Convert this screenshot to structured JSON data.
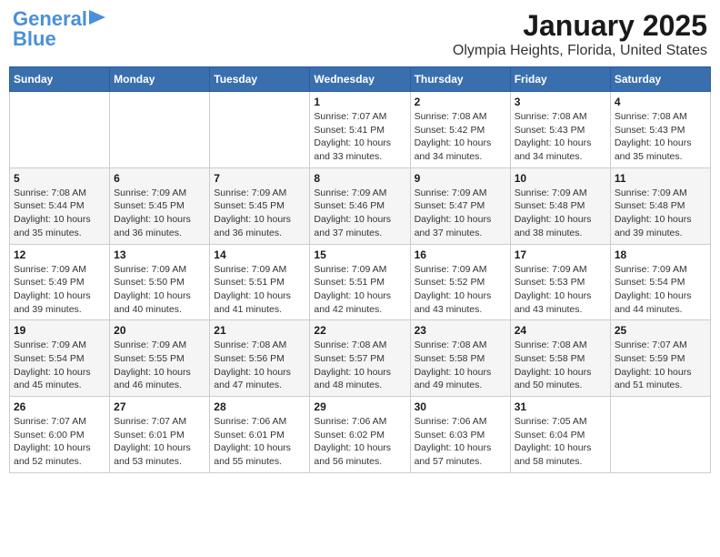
{
  "header": {
    "logo_line1": "General",
    "logo_line2": "Blue",
    "title": "January 2025",
    "subtitle": "Olympia Heights, Florida, United States"
  },
  "weekdays": [
    "Sunday",
    "Monday",
    "Tuesday",
    "Wednesday",
    "Thursday",
    "Friday",
    "Saturday"
  ],
  "weeks": [
    [
      {
        "day": "",
        "info": ""
      },
      {
        "day": "",
        "info": ""
      },
      {
        "day": "",
        "info": ""
      },
      {
        "day": "1",
        "info": "Sunrise: 7:07 AM\nSunset: 5:41 PM\nDaylight: 10 hours\nand 33 minutes."
      },
      {
        "day": "2",
        "info": "Sunrise: 7:08 AM\nSunset: 5:42 PM\nDaylight: 10 hours\nand 34 minutes."
      },
      {
        "day": "3",
        "info": "Sunrise: 7:08 AM\nSunset: 5:43 PM\nDaylight: 10 hours\nand 34 minutes."
      },
      {
        "day": "4",
        "info": "Sunrise: 7:08 AM\nSunset: 5:43 PM\nDaylight: 10 hours\nand 35 minutes."
      }
    ],
    [
      {
        "day": "5",
        "info": "Sunrise: 7:08 AM\nSunset: 5:44 PM\nDaylight: 10 hours\nand 35 minutes."
      },
      {
        "day": "6",
        "info": "Sunrise: 7:09 AM\nSunset: 5:45 PM\nDaylight: 10 hours\nand 36 minutes."
      },
      {
        "day": "7",
        "info": "Sunrise: 7:09 AM\nSunset: 5:45 PM\nDaylight: 10 hours\nand 36 minutes."
      },
      {
        "day": "8",
        "info": "Sunrise: 7:09 AM\nSunset: 5:46 PM\nDaylight: 10 hours\nand 37 minutes."
      },
      {
        "day": "9",
        "info": "Sunrise: 7:09 AM\nSunset: 5:47 PM\nDaylight: 10 hours\nand 37 minutes."
      },
      {
        "day": "10",
        "info": "Sunrise: 7:09 AM\nSunset: 5:48 PM\nDaylight: 10 hours\nand 38 minutes."
      },
      {
        "day": "11",
        "info": "Sunrise: 7:09 AM\nSunset: 5:48 PM\nDaylight: 10 hours\nand 39 minutes."
      }
    ],
    [
      {
        "day": "12",
        "info": "Sunrise: 7:09 AM\nSunset: 5:49 PM\nDaylight: 10 hours\nand 39 minutes."
      },
      {
        "day": "13",
        "info": "Sunrise: 7:09 AM\nSunset: 5:50 PM\nDaylight: 10 hours\nand 40 minutes."
      },
      {
        "day": "14",
        "info": "Sunrise: 7:09 AM\nSunset: 5:51 PM\nDaylight: 10 hours\nand 41 minutes."
      },
      {
        "day": "15",
        "info": "Sunrise: 7:09 AM\nSunset: 5:51 PM\nDaylight: 10 hours\nand 42 minutes."
      },
      {
        "day": "16",
        "info": "Sunrise: 7:09 AM\nSunset: 5:52 PM\nDaylight: 10 hours\nand 43 minutes."
      },
      {
        "day": "17",
        "info": "Sunrise: 7:09 AM\nSunset: 5:53 PM\nDaylight: 10 hours\nand 43 minutes."
      },
      {
        "day": "18",
        "info": "Sunrise: 7:09 AM\nSunset: 5:54 PM\nDaylight: 10 hours\nand 44 minutes."
      }
    ],
    [
      {
        "day": "19",
        "info": "Sunrise: 7:09 AM\nSunset: 5:54 PM\nDaylight: 10 hours\nand 45 minutes."
      },
      {
        "day": "20",
        "info": "Sunrise: 7:09 AM\nSunset: 5:55 PM\nDaylight: 10 hours\nand 46 minutes."
      },
      {
        "day": "21",
        "info": "Sunrise: 7:08 AM\nSunset: 5:56 PM\nDaylight: 10 hours\nand 47 minutes."
      },
      {
        "day": "22",
        "info": "Sunrise: 7:08 AM\nSunset: 5:57 PM\nDaylight: 10 hours\nand 48 minutes."
      },
      {
        "day": "23",
        "info": "Sunrise: 7:08 AM\nSunset: 5:58 PM\nDaylight: 10 hours\nand 49 minutes."
      },
      {
        "day": "24",
        "info": "Sunrise: 7:08 AM\nSunset: 5:58 PM\nDaylight: 10 hours\nand 50 minutes."
      },
      {
        "day": "25",
        "info": "Sunrise: 7:07 AM\nSunset: 5:59 PM\nDaylight: 10 hours\nand 51 minutes."
      }
    ],
    [
      {
        "day": "26",
        "info": "Sunrise: 7:07 AM\nSunset: 6:00 PM\nDaylight: 10 hours\nand 52 minutes."
      },
      {
        "day": "27",
        "info": "Sunrise: 7:07 AM\nSunset: 6:01 PM\nDaylight: 10 hours\nand 53 minutes."
      },
      {
        "day": "28",
        "info": "Sunrise: 7:06 AM\nSunset: 6:01 PM\nDaylight: 10 hours\nand 55 minutes."
      },
      {
        "day": "29",
        "info": "Sunrise: 7:06 AM\nSunset: 6:02 PM\nDaylight: 10 hours\nand 56 minutes."
      },
      {
        "day": "30",
        "info": "Sunrise: 7:06 AM\nSunset: 6:03 PM\nDaylight: 10 hours\nand 57 minutes."
      },
      {
        "day": "31",
        "info": "Sunrise: 7:05 AM\nSunset: 6:04 PM\nDaylight: 10 hours\nand 58 minutes."
      },
      {
        "day": "",
        "info": ""
      }
    ]
  ]
}
